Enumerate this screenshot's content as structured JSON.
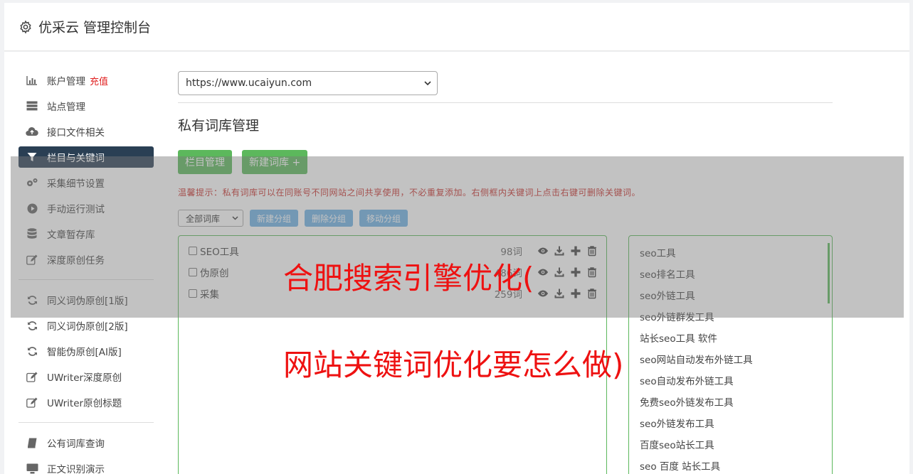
{
  "header": {
    "title": "优采云 管理控制台"
  },
  "sidebar": {
    "group1": [
      {
        "label": "账户管理",
        "extra": "充值",
        "icon": "bar-chart-icon"
      },
      {
        "label": "站点管理",
        "icon": "server-icon"
      },
      {
        "label": "接口文件相关",
        "icon": "cloud-upload-icon"
      },
      {
        "label": "栏目与关键词",
        "icon": "filter-icon",
        "active": true
      },
      {
        "label": "采集细节设置",
        "icon": "cogs-icon"
      },
      {
        "label": "手动运行测试",
        "icon": "play-circle-icon"
      },
      {
        "label": "文章暂存库",
        "icon": "database-icon"
      },
      {
        "label": "深度原创任务",
        "icon": "edit-icon"
      }
    ],
    "group2": [
      {
        "label": "同义词伪原创[1版]",
        "icon": "refresh-icon"
      },
      {
        "label": "同义词伪原创[2版]",
        "icon": "refresh-icon"
      },
      {
        "label": "智能伪原创[AI版]",
        "icon": "refresh-icon"
      },
      {
        "label": "UWriter深度原创",
        "icon": "edit-icon"
      },
      {
        "label": "UWriter原创标题",
        "icon": "edit-icon"
      }
    ],
    "group3": [
      {
        "label": "公有词库查询",
        "icon": "book-icon"
      },
      {
        "label": "正文识别演示",
        "icon": "monitor-icon"
      }
    ]
  },
  "content": {
    "site_select": "https://www.ucaiyun.com",
    "page_title": "私有词库管理",
    "btn_column": "栏目管理",
    "btn_new_lib": "新建词库 +",
    "tip": "温馨提示：私有词库可以在同账号不同网站之间共享使用，不必重复添加。右侧框内关键词上点击右键可删除关键词。",
    "group_select": "全部词库",
    "btn_new_group": "新建分组",
    "btn_del_group": "删除分组",
    "btn_move_group": "移动分组",
    "libraries": [
      {
        "name": "SEO工具",
        "count": "98词"
      },
      {
        "name": "伪原创",
        "count": "486词"
      },
      {
        "name": "采集",
        "count": "259词"
      }
    ],
    "keywords": [
      "seo工具",
      "seo排名工具",
      "seo外链工具",
      "seo外链群发工具",
      "站长seo工具 软件",
      "seo网站自动发布外链工具",
      "seo自动发布外链工具",
      "免费seo外链发布工具",
      "seo外链发布工具",
      "百度seo站长工具",
      "seo 百度 站长工具"
    ]
  },
  "overlay": {
    "line1": "合肥搜索引擎优化(",
    "line2": "网站关键词优化要怎么做)"
  },
  "colors": {
    "accent_green": "#5cb85c",
    "active_bg": "#2a3f54",
    "overlay_text": "#ee1111"
  }
}
